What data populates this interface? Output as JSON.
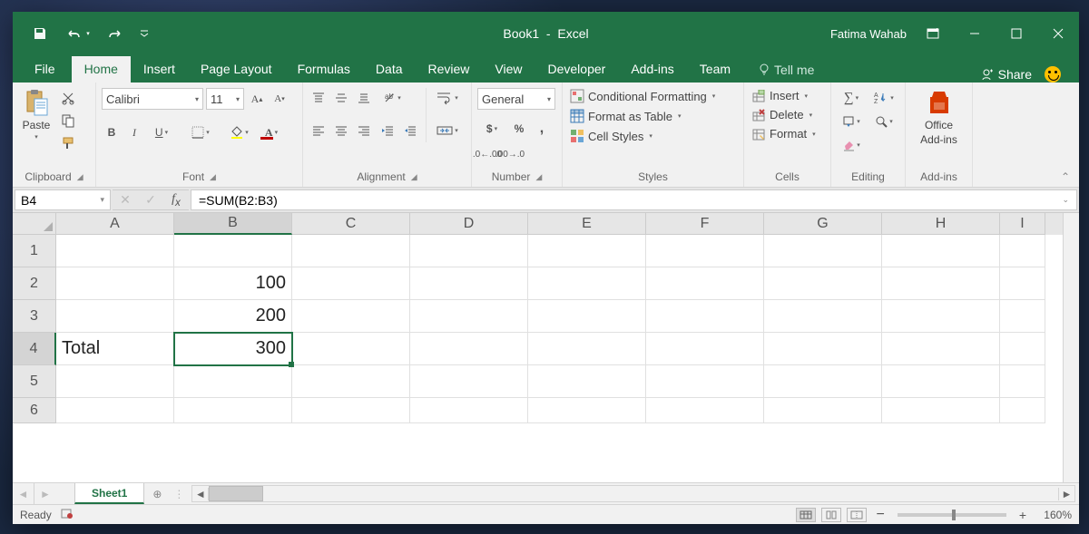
{
  "title": {
    "doc": "Book1",
    "app": "Excel"
  },
  "user": "Fatima Wahab",
  "tabs": [
    "File",
    "Home",
    "Insert",
    "Page Layout",
    "Formulas",
    "Data",
    "Review",
    "View",
    "Developer",
    "Add-ins",
    "Team"
  ],
  "active_tab": "Home",
  "tellme": "Tell me",
  "share": "Share",
  "ribbon": {
    "clipboard": {
      "label": "Clipboard",
      "paste": "Paste"
    },
    "font": {
      "label": "Font",
      "name": "Calibri",
      "size": "11"
    },
    "alignment": {
      "label": "Alignment"
    },
    "number": {
      "label": "Number",
      "format": "General"
    },
    "styles": {
      "label": "Styles",
      "cond": "Conditional Formatting",
      "table": "Format as Table",
      "cell": "Cell Styles"
    },
    "cells": {
      "label": "Cells",
      "insert": "Insert",
      "delete": "Delete",
      "format": "Format"
    },
    "editing": {
      "label": "Editing"
    },
    "addins": {
      "label": "Add-ins",
      "office": "Office",
      "addins_line": "Add-ins"
    }
  },
  "namebox": "B4",
  "formula": "=SUM(B2:B3)",
  "columns": [
    "A",
    "B",
    "C",
    "D",
    "E",
    "F",
    "G",
    "H",
    "I"
  ],
  "active_col": "B",
  "rows": [
    "1",
    "2",
    "3",
    "4",
    "5",
    "6"
  ],
  "active_row": "4",
  "cells": {
    "A4": "Total",
    "B2": "100",
    "B3": "200",
    "B4": "300"
  },
  "sheet": "Sheet1",
  "status": {
    "ready": "Ready",
    "zoom": "160%"
  }
}
